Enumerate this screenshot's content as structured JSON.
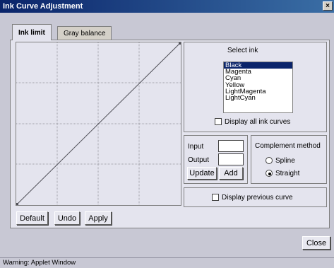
{
  "window": {
    "title": "Ink Curve Adjustment",
    "close_glyph": "×"
  },
  "tabs": [
    {
      "label": "Ink limit",
      "active": true
    },
    {
      "label": "Gray balance",
      "active": false
    }
  ],
  "select_ink": {
    "label": "Select ink",
    "items": [
      "Black",
      "Magenta",
      "Cyan",
      "Yellow",
      "LightMagenta",
      "LightCyan"
    ],
    "selected": "Black",
    "display_all_label": "Display all ink curves",
    "display_all_checked": false
  },
  "io": {
    "input_label": "Input",
    "input_value": "",
    "output_label": "Output",
    "output_value": "",
    "update_label": "Update",
    "add_label": "Add"
  },
  "complement": {
    "label": "Complement method",
    "options": [
      {
        "label": "Spline",
        "checked": false
      },
      {
        "label": "Straight",
        "checked": true
      }
    ]
  },
  "previous_curve": {
    "label": "Display previous curve",
    "checked": false
  },
  "buttons": {
    "default": "Default",
    "undo": "Undo",
    "apply": "Apply",
    "close": "Close"
  },
  "status": "Warning: Applet Window",
  "colors": {
    "title_start": "#0a246a",
    "title_end": "#3a6ea5",
    "panel": "#e4e4ee",
    "selection": "#0a246a"
  }
}
